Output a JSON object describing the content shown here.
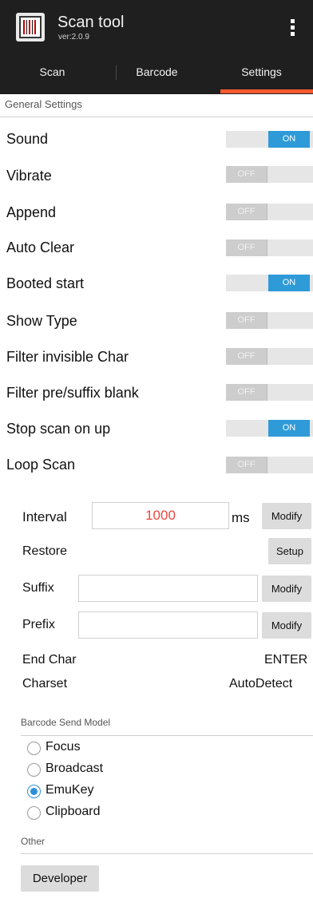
{
  "header": {
    "title": "Scan tool",
    "version": "ver:2.0.9",
    "icon": "barcode-app-icon",
    "menu_icon": "more-vert-icon"
  },
  "tabs": [
    {
      "label": "Scan",
      "active": false
    },
    {
      "label": "Barcode",
      "active": false
    },
    {
      "label": "Settings",
      "active": true
    }
  ],
  "colors": {
    "accent_tab": "#ff5a2e",
    "toggle_on": "#2f9ad8",
    "interval_text": "#e8483d",
    "bar_bg": "#1f1f1f"
  },
  "general": {
    "header": "General Settings",
    "toggles": [
      {
        "label": "Sound",
        "state": "ON"
      },
      {
        "label": "Vibrate",
        "state": "OFF"
      },
      {
        "label": "Append",
        "state": "OFF"
      },
      {
        "label": "Auto Clear",
        "state": "OFF"
      },
      {
        "label": "Booted start",
        "state": "ON"
      },
      {
        "label": "Show Type",
        "state": "OFF"
      },
      {
        "label": "Filter invisible Char",
        "state": "OFF"
      },
      {
        "label": "Filter pre/suffix blank",
        "state": "OFF"
      },
      {
        "label": "Stop scan on up",
        "state": "ON"
      },
      {
        "label": "Loop Scan",
        "state": "OFF"
      }
    ]
  },
  "options": {
    "interval": {
      "label": "Interval",
      "value": "1000",
      "unit": "ms",
      "button": "Modify"
    },
    "restore": {
      "label": "Restore",
      "button": "Setup"
    },
    "suffix": {
      "label": "Suffix",
      "value": "",
      "button": "Modify"
    },
    "prefix": {
      "label": "Prefix",
      "value": "",
      "button": "Modify"
    },
    "end_char": {
      "label": "End Char",
      "value": "ENTER"
    },
    "charset": {
      "label": "Charset",
      "value": "AutoDetect"
    }
  },
  "send_model": {
    "header": "Barcode Send Model",
    "options": [
      {
        "label": "Focus",
        "checked": false
      },
      {
        "label": "Broadcast",
        "checked": false
      },
      {
        "label": "EmuKey",
        "checked": true
      },
      {
        "label": "Clipboard",
        "checked": false
      }
    ]
  },
  "other": {
    "header": "Other",
    "developer_button": "Developer"
  }
}
